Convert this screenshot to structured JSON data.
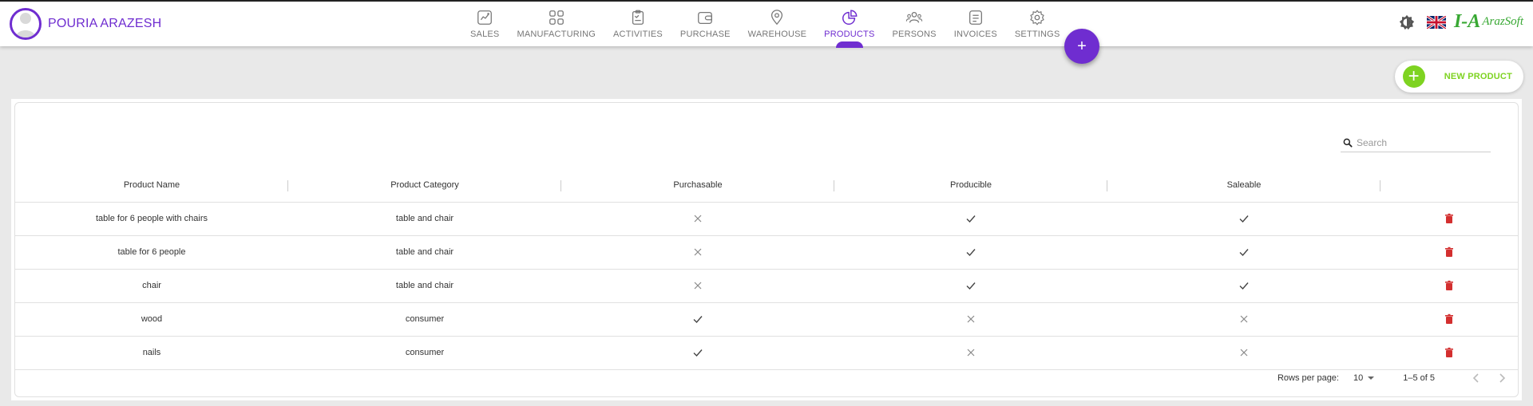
{
  "user": {
    "name": "POURIA ARAZESH"
  },
  "nav": [
    {
      "label": "SALES",
      "icon": "sales-chart-icon"
    },
    {
      "label": "MANUFACTURING",
      "icon": "grid-icon"
    },
    {
      "label": "ACTIVITIES",
      "icon": "clipboard-icon"
    },
    {
      "label": "PURCHASE",
      "icon": "wallet-icon"
    },
    {
      "label": "WAREHOUSE",
      "icon": "location-pin-icon"
    },
    {
      "label": "PRODUCTS",
      "icon": "pie-chart-icon",
      "active": true
    },
    {
      "label": "PERSONS",
      "icon": "people-icon"
    },
    {
      "label": "INVOICES",
      "icon": "document-icon"
    },
    {
      "label": "SETTINGS",
      "icon": "gear-icon"
    }
  ],
  "fab": {
    "label": "+"
  },
  "logo": {
    "text": "ArazSoft"
  },
  "toolbar": {
    "new_product_label": "NEW PRODUCT"
  },
  "search": {
    "placeholder": "Search",
    "value": ""
  },
  "table": {
    "columns": [
      "Product Name",
      "Product Category",
      "Purchasable",
      "Producible",
      "Saleable",
      ""
    ],
    "rows": [
      {
        "name": "table for 6 people with chairs",
        "category": "table and chair",
        "purchasable": false,
        "producible": true,
        "saleable": true
      },
      {
        "name": "table for 6 people",
        "category": "table and chair",
        "purchasable": false,
        "producible": true,
        "saleable": true
      },
      {
        "name": "chair",
        "category": "table and chair",
        "purchasable": false,
        "producible": true,
        "saleable": true
      },
      {
        "name": "wood",
        "category": "consumer",
        "purchasable": true,
        "producible": false,
        "saleable": false
      },
      {
        "name": "nails",
        "category": "consumer",
        "purchasable": true,
        "producible": false,
        "saleable": false
      }
    ]
  },
  "pagination": {
    "rows_per_page_label": "Rows per page:",
    "rows_per_page": "10",
    "range": "1–5 of 5"
  },
  "colors": {
    "accent": "#6f2dd0",
    "success": "#7ed321",
    "danger": "#d32f2f"
  }
}
